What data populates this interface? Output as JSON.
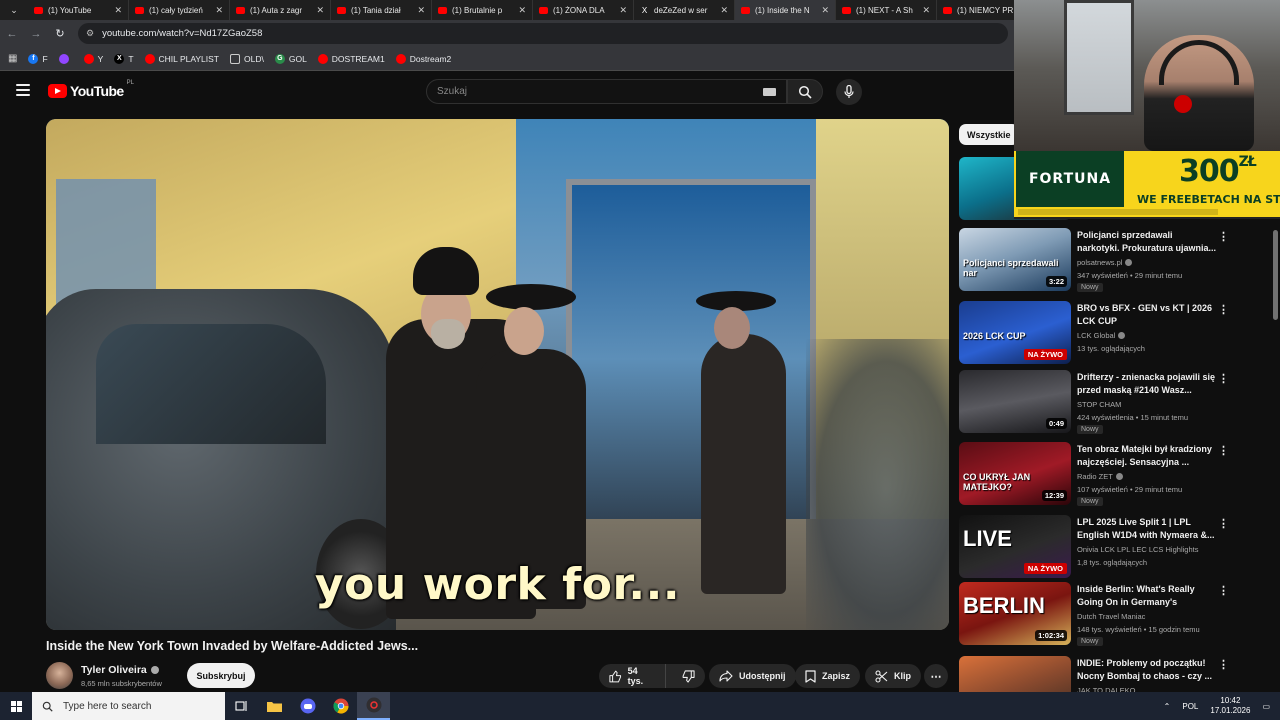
{
  "browser": {
    "tabs": [
      {
        "label": "(1) YouTube",
        "icon": "youtube-favicon",
        "active": false
      },
      {
        "label": "(1) cały tydzień",
        "icon": "youtube-favicon",
        "active": false
      },
      {
        "label": "(1) Auta z zagr",
        "icon": "youtube-favicon",
        "active": false
      },
      {
        "label": "(1) Tania dział",
        "icon": "youtube-favicon",
        "active": false
      },
      {
        "label": "(1) Brutalnie p",
        "icon": "youtube-favicon",
        "active": false
      },
      {
        "label": "(1) ŻONA DLA",
        "icon": "youtube-favicon",
        "active": false
      },
      {
        "label": "deZeZed w ser",
        "icon": "x-favicon",
        "active": false
      },
      {
        "label": "(1) Inside the N",
        "icon": "youtube-favicon",
        "active": true
      },
      {
        "label": "(1) NEXT - A Sh",
        "icon": "youtube-favicon",
        "active": false
      },
      {
        "label": "(1) NIEMCY PR",
        "icon": "youtube-favicon",
        "active": false
      }
    ],
    "url": "youtube.com/watch?v=Nd17ZGaoZ58",
    "bookmarks": [
      {
        "label": "F",
        "color": "#1877f2",
        "glyph": "f"
      },
      {
        "label": "",
        "color": "#9146ff",
        "glyph": ""
      },
      {
        "label": "Y",
        "color": "#ff0000",
        "glyph": ""
      },
      {
        "label": "T",
        "color": "#000000",
        "glyph": "X"
      },
      {
        "label": "CHIL PLAYLIST",
        "color": "#ff0000",
        "glyph": ""
      },
      {
        "label": "OLD\\",
        "color": "",
        "glyph": ""
      },
      {
        "label": "GOL",
        "color": "#2a8c4a",
        "glyph": "G"
      },
      {
        "label": "DOSTREAM1",
        "color": "#ff0000",
        "glyph": ""
      },
      {
        "label": "Dostream2",
        "color": "#ff0000",
        "glyph": ""
      }
    ]
  },
  "youtube": {
    "logo_text": "YouTube",
    "region": "PL",
    "search_placeholder": "Szukaj"
  },
  "video": {
    "subtitle": "you work for...",
    "title": "Inside the New York Town Invaded by Welfare-Addicted Jews...",
    "channel": "Tyler Oliveira",
    "subscribers": "8,65 mln subskrybentów",
    "subscribe_label": "Subskrybuj",
    "likes": "54 tys.",
    "share_label": "Udostępnij",
    "save_label": "Zapisz",
    "clip_label": "Klip"
  },
  "sidebar": {
    "chip": "Wszystkie",
    "items": [
      {
        "title": "Policjanci sprzedawali narkotyki. Prokuratura ujawnia...",
        "channel": "polsatnews.pl",
        "verified": true,
        "meta": "347 wyświetleń • 29 minut temu",
        "badge": "Nowy",
        "duration": "3:22",
        "live": "",
        "thumb_caption": "Policjanci sprzedawali nar",
        "thumb_bg": "linear-gradient(160deg,#c9d6e3 0%,#7f9bb5 45%,#1b3a5c 100%)"
      },
      {
        "title": "BRO vs BFX - GEN vs KT | 2026 LCK CUP",
        "channel": "LCK Global",
        "verified": true,
        "meta": "13 tys. oglądających",
        "badge": "",
        "duration": "",
        "live": "NA ŻYWO",
        "thumb_caption": "2026 LCK CUP",
        "thumb_bg": "linear-gradient(160deg,#1a3d8f 0%,#2b5fd1 55%,#0d1f4d 100%)"
      },
      {
        "title": "Drifterzy - znienacka pojawili się przed maską #2140 Wasz...",
        "channel": "STOP CHAM",
        "verified": false,
        "meta": "424 wyświetlenia • 15 minut temu",
        "badge": "Nowy",
        "duration": "0:49",
        "live": "",
        "thumb_caption": "",
        "thumb_bg": "linear-gradient(170deg,#2a2a2e 0%,#5a5a60 50%,#17171a 100%)"
      },
      {
        "title": "Ten obraz Matejki był kradziony najczęściej. Sensacyjna ...",
        "channel": "Radio ZET",
        "verified": true,
        "meta": "107 wyświetleń • 29 minut temu",
        "badge": "Nowy",
        "duration": "12:39",
        "live": "",
        "thumb_caption": "CO UKRYŁ JAN MATEJKO?",
        "thumb_bg": "linear-gradient(160deg,#5a0d14 0%,#a01a26 55%,#2a0509 100%)"
      },
      {
        "title": "LPL 2025 Live Split 1 | LPL English W1D4 with Nymaera &...",
        "channel": "Onivia LCK LPL LEC LCS Highlights",
        "verified": false,
        "meta": "1,8 tys. oglądających",
        "badge": "",
        "duration": "",
        "live": "NA ŻYWO",
        "thumb_caption": "LIVE",
        "thumb_bg": "linear-gradient(160deg,#111 0%,#2b2b2b 55%,#3a1a4d 100%)"
      },
      {
        "title": "Inside Berlin: What's Really Going On in Germany's Capital...",
        "channel": "Dutch Travel Maniac",
        "verified": false,
        "meta": "148 tys. wyświetleń • 15 godzin temu",
        "badge": "Nowy",
        "duration": "1:02:34",
        "live": "",
        "thumb_caption": "BERLIN",
        "thumb_bg": "linear-gradient(160deg,#c02a1f 0%,#7a1510 50%,#d6b35a 100%)"
      },
      {
        "title": "INDIE: Problemy od początku! Nocny Bombaj to chaos - czy ...",
        "channel": "JAK TO DALEKO",
        "verified": false,
        "meta": "",
        "badge": "",
        "duration": "",
        "live": "",
        "thumb_caption": "",
        "thumb_bg": "linear-gradient(160deg,#d9713a 0%,#8a4a2e 50%,#3a2a22 100%)"
      }
    ]
  },
  "overlay": {
    "ad_brand": "FORTUNA",
    "ad_amount": "300",
    "ad_currency": "ZŁ",
    "ad_tagline": "WE FREEBETACH NA STAR"
  },
  "taskbar": {
    "search_placeholder": "Type here to search",
    "language": "POL",
    "time": "10:42",
    "date": "17.01.2026"
  },
  "colors": {
    "youtube_red": "#ff0000",
    "background": "#0f0f0f",
    "fortuna_yellow": "#f7d51c",
    "fortuna_green": "#0b3f24"
  }
}
